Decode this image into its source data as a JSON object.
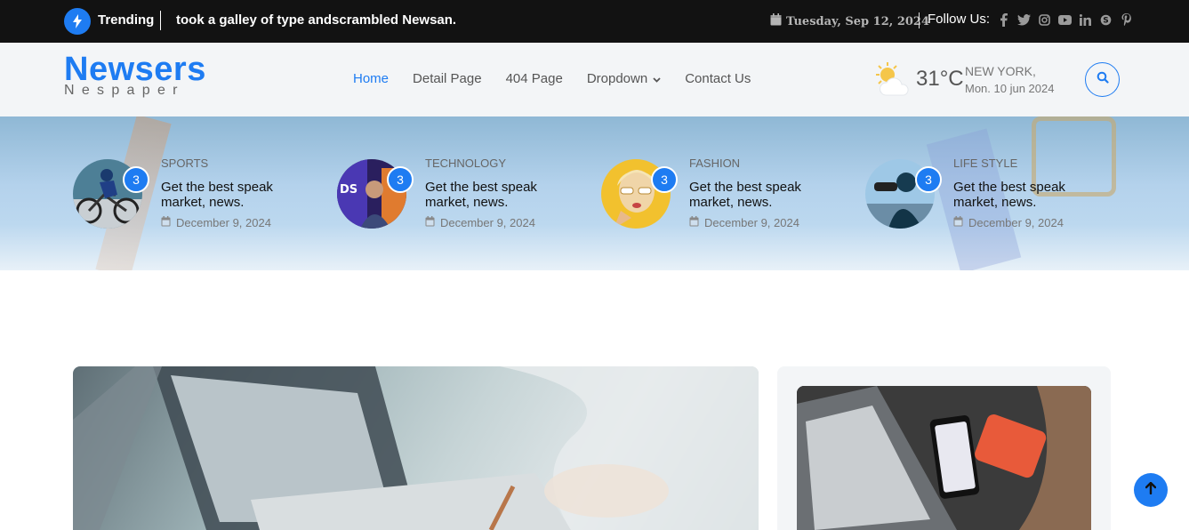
{
  "topbar": {
    "trending_label": "Trending",
    "trending_text": "took a galley of type andscrambled Newsan.",
    "date": "Tuesday, Sep 12, 2024",
    "follow_label": "Follow Us:",
    "social_icons": [
      "facebook-icon",
      "twitter-icon",
      "instagram-icon",
      "youtube-icon",
      "linkedin-icon",
      "skype-icon",
      "pinterest-icon"
    ]
  },
  "logo": {
    "main": "Newsers",
    "sub": "Nespaper"
  },
  "nav": {
    "items": [
      {
        "label": "Home",
        "active": true
      },
      {
        "label": "Detail Page"
      },
      {
        "label": "404 Page"
      },
      {
        "label": "Dropdown",
        "has_dropdown": true
      },
      {
        "label": "Contact Us"
      }
    ]
  },
  "weather": {
    "temp": "31°C",
    "city": "NEW YORK,",
    "date": "Mon. 10 jun 2024"
  },
  "stories": [
    {
      "category": "SPORTS",
      "badge": "3",
      "title": "Get the best speak market, news.",
      "date": "December 9, 2024"
    },
    {
      "category": "TECHNOLOGY",
      "badge": "3",
      "title": "Get the best speak market, news.",
      "date": "December 9, 2024"
    },
    {
      "category": "FASHION",
      "badge": "3",
      "title": "Get the best speak market, news.",
      "date": "December 9, 2024"
    },
    {
      "category": "LIFE STYLE",
      "badge": "3",
      "title": "Get the best speak market, news.",
      "date": "December 9, 2024"
    }
  ],
  "colors": {
    "accent": "#1e7cf2",
    "topbar_bg": "#121212",
    "header_bg": "#f3f5f7"
  }
}
